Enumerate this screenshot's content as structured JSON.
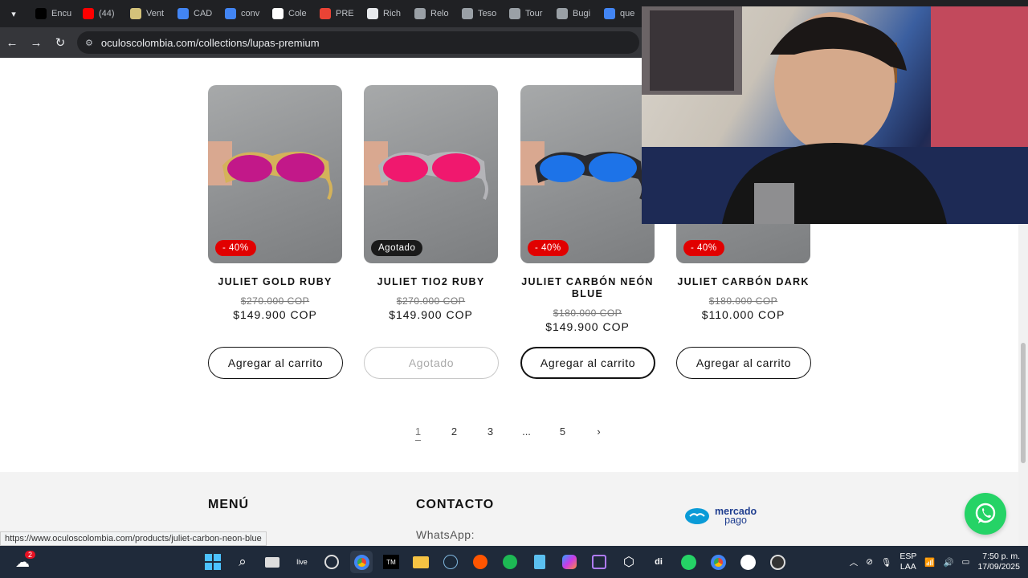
{
  "browser": {
    "tabs": [
      {
        "label": "Encu",
        "color": "#000000"
      },
      {
        "label": "(44)",
        "color": "#ff0000"
      },
      {
        "label": "Vent",
        "color": "#d4c27a"
      },
      {
        "label": "CAD",
        "color": "#4285f4"
      },
      {
        "label": "conv",
        "color": "#4285f4"
      },
      {
        "label": "Cole",
        "color": "#ffffff"
      },
      {
        "label": "PRE",
        "color": "#ea4335"
      },
      {
        "label": "Rich",
        "color": "#e8eaed"
      },
      {
        "label": "Relo",
        "color": "#9aa0a6"
      },
      {
        "label": "Teso",
        "color": "#9aa0a6"
      },
      {
        "label": "Tour",
        "color": "#9aa0a6"
      },
      {
        "label": "Bugi",
        "color": "#9aa0a6"
      },
      {
        "label": "que",
        "color": "#4285f4"
      }
    ],
    "url": "oculoscolombia.com/collections/lupas-premium",
    "status_url": "https://www.oculoscolombia.com/products/juliet-carbon-neon-blue"
  },
  "products": [
    {
      "name": "JULIET GOLD RUBY",
      "badge": "- 40%",
      "badge_type": "sale",
      "old_price": "$270.000 COP",
      "price": "$149.900 COP",
      "button": "Agregar al carrito",
      "lens": "#c21889",
      "frame": "#d4b25a"
    },
    {
      "name": "JULIET TIO2 RUBY",
      "badge": "Agotado",
      "badge_type": "sold",
      "old_price": "$270.000 COP",
      "price": "$149.900 COP",
      "button": "Agotado",
      "lens": "#f0186e",
      "frame": "#b4b4b8"
    },
    {
      "name": "JULIET CARBÓN NEÓN BLUE",
      "badge": "- 40%",
      "badge_type": "sale",
      "old_price": "$180.000 COP",
      "price": "$149.900 COP",
      "button": "Agregar al carrito",
      "lens": "#1d73e8",
      "frame": "#2a2a2e"
    },
    {
      "name": "JULIET CARBÓN DARK",
      "badge": "- 40%",
      "badge_type": "sale",
      "old_price": "$180.000 COP",
      "price": "$110.000 COP",
      "button": "Agregar al carrito",
      "lens": "#222222",
      "frame": "#2a2a2e"
    }
  ],
  "pagination": {
    "pages": [
      "1",
      "2",
      "3",
      "...",
      "5"
    ],
    "current": "1",
    "next": "›"
  },
  "footer": {
    "menu_heading": "MENÚ",
    "contact_heading": "CONTACTO",
    "whatsapp_label": "WhatsApp:",
    "mercado_pago_line1": "mercado",
    "mercado_pago_line2": "pago"
  },
  "taskbar": {
    "notification_count": "2",
    "language": "ESP",
    "layout": "LAA",
    "time": "7:50 p. m.",
    "date": "17/09/2025"
  }
}
